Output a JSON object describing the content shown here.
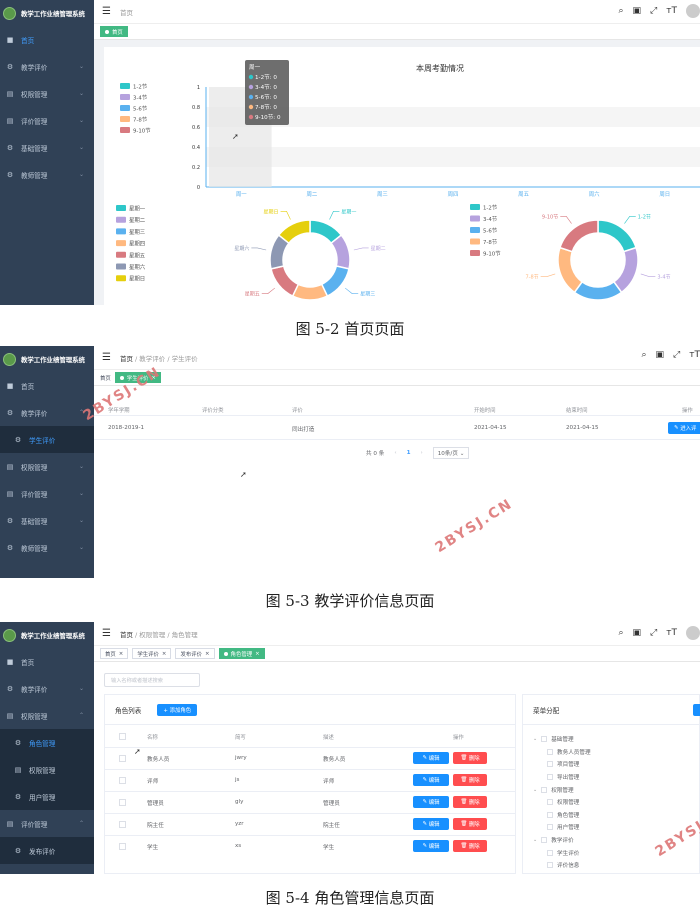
{
  "app_title": "教学工作业绩管理系统",
  "p1": {
    "menu": [
      {
        "icon": "■",
        "label": "首页",
        "arrow": ""
      },
      {
        "icon": "⚙",
        "label": "教学评价",
        "arrow": "⌄"
      },
      {
        "icon": "▤",
        "label": "权限管理",
        "arrow": "⌄"
      },
      {
        "icon": "▤",
        "label": "评价管理",
        "arrow": "⌄"
      },
      {
        "icon": "⚙",
        "label": "基础管理",
        "arrow": "⌄"
      },
      {
        "icon": "⚙",
        "label": "教师管理",
        "arrow": "⌄"
      }
    ],
    "breadcrumb": "首页",
    "tag": "首页",
    "chart_title": "本周考勤情况",
    "caption": "图 5-2 首页页面"
  },
  "p2": {
    "menu": [
      {
        "icon": "■",
        "label": "首页",
        "arrow": ""
      },
      {
        "icon": "⚙",
        "label": "教学评价",
        "arrow": "⌃"
      },
      {
        "icon": "⚙",
        "label": "学生评价",
        "arrow": ""
      },
      {
        "icon": "▤",
        "label": "权限管理",
        "arrow": "⌄"
      },
      {
        "icon": "▤",
        "label": "评价管理",
        "arrow": "⌄"
      },
      {
        "icon": "⚙",
        "label": "基础管理",
        "arrow": "⌄"
      },
      {
        "icon": "⚙",
        "label": "教师管理",
        "arrow": "⌄"
      }
    ],
    "breadcrumb": [
      "首页",
      "教学评价",
      "学生评价"
    ],
    "tags": [
      "首页",
      "学生评价"
    ],
    "columns": [
      "学年学期",
      "评价分类",
      "评价",
      "开始时间",
      "结束时间",
      "操作"
    ],
    "row": [
      "2018-2019-1",
      "",
      "同出打造",
      "2021-04-15",
      "2021-04-15",
      "进入评"
    ],
    "pager": {
      "total": "共 0 条",
      "page": "1",
      "size": "10条/页"
    },
    "caption": "图 5-3 教学评价信息页面"
  },
  "p3": {
    "menu": [
      {
        "icon": "■",
        "label": "首页",
        "arrow": ""
      },
      {
        "icon": "⚙",
        "label": "教学评价",
        "arrow": "⌄"
      },
      {
        "icon": "▤",
        "label": "权限管理",
        "arrow": "⌃"
      },
      {
        "icon": "⚙",
        "label": "角色管理",
        "arrow": ""
      },
      {
        "icon": "▤",
        "label": "权限管理",
        "arrow": ""
      },
      {
        "icon": "⚙",
        "label": "用户管理",
        "arrow": ""
      },
      {
        "icon": "▤",
        "label": "评价管理",
        "arrow": "⌃"
      },
      {
        "icon": "⚙",
        "label": "发布评价",
        "arrow": ""
      },
      {
        "icon": "⚙",
        "label": "基础管理",
        "arrow": "⌄"
      }
    ],
    "breadcrumb": [
      "首页",
      "权限管理",
      "角色管理"
    ],
    "tags": [
      "首页",
      "学生评价",
      "发布评价",
      "角色管理"
    ],
    "search_placeholder": "输入名称或者描述搜索",
    "list_title": "角色列表",
    "add_label": "+ 添加角色",
    "columns": [
      "名称",
      "简写",
      "描述",
      "操作"
    ],
    "rows": [
      [
        "教务人员",
        "jwry",
        "教务人员"
      ],
      [
        "评师",
        "js",
        "评师"
      ],
      [
        "管理员",
        "gly",
        "管理员"
      ],
      [
        "院主任",
        "yzr",
        "院主任"
      ],
      [
        "学生",
        "xs",
        "学生"
      ]
    ],
    "edit_label": "编辑",
    "del_label": "删除",
    "menu_title": "菜单分配",
    "tree": [
      {
        "t": "基础管理",
        "l": 0
      },
      {
        "t": "教务人员管理",
        "l": 1
      },
      {
        "t": "项目管理",
        "l": 1
      },
      {
        "t": "导出管理",
        "l": 1
      },
      {
        "t": "权限管理",
        "l": 0
      },
      {
        "t": "权限管理",
        "l": 1
      },
      {
        "t": "角色管理",
        "l": 1
      },
      {
        "t": "用户管理",
        "l": 1
      },
      {
        "t": "教学评价",
        "l": 0
      },
      {
        "t": "学生评价",
        "l": 1
      },
      {
        "t": "评价信息",
        "l": 1
      }
    ],
    "caption": "图 5-4 角色管理信息页面"
  },
  "watermark": "2BYSJ.CN",
  "chart_data": [
    {
      "type": "bar",
      "title": "本周考勤情况",
      "categories": [
        "周一",
        "周二",
        "周三",
        "周四",
        "周五",
        "周六",
        "周日"
      ],
      "series": [
        {
          "name": "1-2节",
          "values": [
            0,
            0,
            0,
            0,
            0,
            0,
            0
          ]
        },
        {
          "name": "3-4节",
          "values": [
            0,
            0,
            0,
            0,
            0,
            0,
            0
          ]
        },
        {
          "name": "5-6节",
          "values": [
            0,
            0,
            0,
            0,
            0,
            0,
            0
          ]
        },
        {
          "name": "7-8节",
          "values": [
            0,
            0,
            0,
            0,
            0,
            0,
            0
          ]
        },
        {
          "name": "9-10节",
          "values": [
            0,
            0,
            0,
            0,
            0,
            0,
            0
          ]
        }
      ],
      "yticks": [
        "0",
        "0.2",
        "0.4",
        "0.6",
        "0.8",
        "1"
      ],
      "ylim": [
        0,
        1
      ],
      "legend": "left",
      "tooltip": {
        "title": "周一",
        "items": [
          "1-2节: 0",
          "3-4节: 0",
          "5-6节: 0",
          "7-8节: 0",
          "9-10节: 0"
        ]
      },
      "colors": [
        "#2ec7c9",
        "#b6a2de",
        "#5ab1ef",
        "#ffb980",
        "#d87a80"
      ]
    },
    {
      "type": "pie",
      "legend": [
        "星期一",
        "星期二",
        "星期三",
        "星期四",
        "星期五",
        "星期六",
        "星期日"
      ],
      "outer_labels": [
        "星期一",
        "星期二",
        "星期三",
        "星期四",
        "星期五",
        "星期六",
        "星期日"
      ],
      "values": [
        1,
        1,
        1,
        1,
        1,
        1,
        1
      ],
      "colors": [
        "#2ec7c9",
        "#b6a2de",
        "#5ab1ef",
        "#ffb980",
        "#d87a80",
        "#8d98b3",
        "#e5cf0d"
      ]
    },
    {
      "type": "pie",
      "legend": [
        "1-2节",
        "3-4节",
        "5-6节",
        "7-8节",
        "9-10节"
      ],
      "outer_labels": [
        "1-2节",
        "3-4节",
        "5-6节",
        "7-8节",
        "9-10节"
      ],
      "values": [
        1,
        1,
        1,
        1,
        1
      ],
      "colors": [
        "#2ec7c9",
        "#b6a2de",
        "#5ab1ef",
        "#ffb980",
        "#d87a80"
      ]
    }
  ]
}
